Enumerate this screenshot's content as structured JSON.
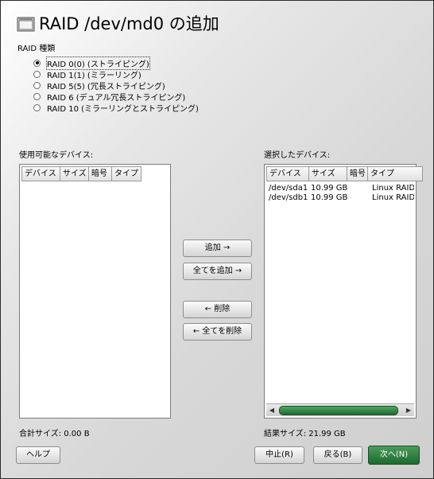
{
  "title": "RAID /dev/md0 の追加",
  "raid_type_label": "RAID 種類",
  "raid_options": [
    {
      "label": "RAID 0(0) (ストライピング)",
      "checked": true
    },
    {
      "label": "RAID 1(1) (ミラーリング)",
      "checked": false
    },
    {
      "label": "RAID 5(5) (冗長ストライピング)",
      "checked": false
    },
    {
      "label": "RAID 6 (デュアル冗長ストライピング)",
      "checked": false
    },
    {
      "label": "RAID 10 (ミラーリングとストライピング)",
      "checked": false
    }
  ],
  "available": {
    "label": "使用可能なデバイス:",
    "columns": [
      "デバイス",
      "サイズ",
      "暗号",
      "タイプ"
    ],
    "rows": [],
    "total": "合計サイズ: 0.00 B"
  },
  "selected": {
    "label": "選択したデバイス:",
    "columns": [
      "デバイス",
      "サイズ",
      "暗号",
      "タイプ"
    ],
    "rows": [
      {
        "device": "/dev/sda1",
        "size": "10.99 GB",
        "enc": "",
        "type": "Linux RAID"
      },
      {
        "device": "/dev/sdb1",
        "size": "10.99 GB",
        "enc": "",
        "type": "Linux RAID"
      }
    ],
    "total": "結果サイズ: 21.99 GB"
  },
  "buttons": {
    "add": "追加 →",
    "add_all": "全てを追加 →",
    "remove": "← 削除",
    "remove_all": "← 全てを削除",
    "help": "ヘルプ",
    "abort": "中止(R)",
    "back": "戻る(B)",
    "next": "次へ(N)"
  },
  "colors": {
    "primary_button": "#1d6b2f",
    "scroll_thumb": "#2f8a44"
  },
  "icons": {
    "title_icon": "window-frame-icon",
    "left_arrow": "scroll-left-arrow-icon",
    "right_arrow": "scroll-right-arrow-icon"
  }
}
